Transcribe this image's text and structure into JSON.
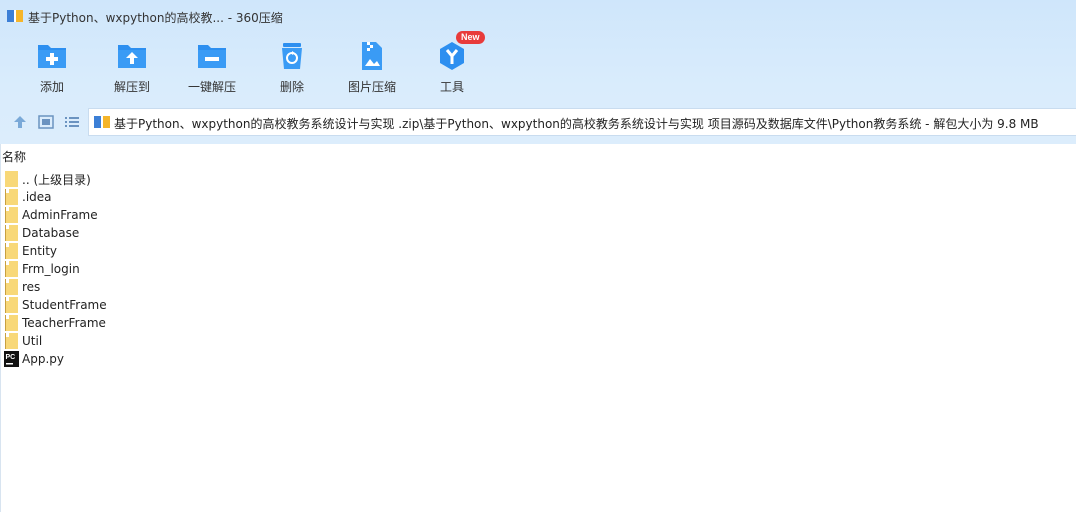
{
  "window": {
    "title": "基于Python、wxpython的高校教... - 360压缩"
  },
  "toolbar": {
    "buttons": [
      {
        "label": "添加",
        "icon": "add-folder-icon"
      },
      {
        "label": "解压到",
        "icon": "extract-to-icon"
      },
      {
        "label": "一键解压",
        "icon": "one-click-extract-icon"
      },
      {
        "label": "删除",
        "icon": "recycle-bin-icon"
      },
      {
        "label": "图片压缩",
        "icon": "image-compress-icon"
      },
      {
        "label": "工具",
        "icon": "tools-icon",
        "badge": "New"
      }
    ]
  },
  "nav": {
    "address": "基于Python、wxpython的高校教务系统设计与实现 .zip\\基于Python、wxpython的高校教务系统设计与实现 项目源码及数据库文件\\Python教务系统 - 解包大小为 9.8 MB"
  },
  "file_list": {
    "column_name": "名称",
    "items": [
      {
        "name": ".. (上级目录)",
        "type": "parent"
      },
      {
        "name": ".idea",
        "type": "folder"
      },
      {
        "name": "AdminFrame",
        "type": "folder"
      },
      {
        "name": "Database",
        "type": "folder"
      },
      {
        "name": "Entity",
        "type": "folder"
      },
      {
        "name": "Frm_login",
        "type": "folder"
      },
      {
        "name": "res",
        "type": "folder"
      },
      {
        "name": "StudentFrame",
        "type": "folder"
      },
      {
        "name": "TeacherFrame",
        "type": "folder"
      },
      {
        "name": "Util",
        "type": "folder"
      },
      {
        "name": "App.py",
        "type": "pycharm-file"
      }
    ]
  },
  "colors": {
    "accent_blue": "#2d8ff0",
    "folder_yellow": "#f8d878",
    "badge_red": "#e83b3b"
  }
}
